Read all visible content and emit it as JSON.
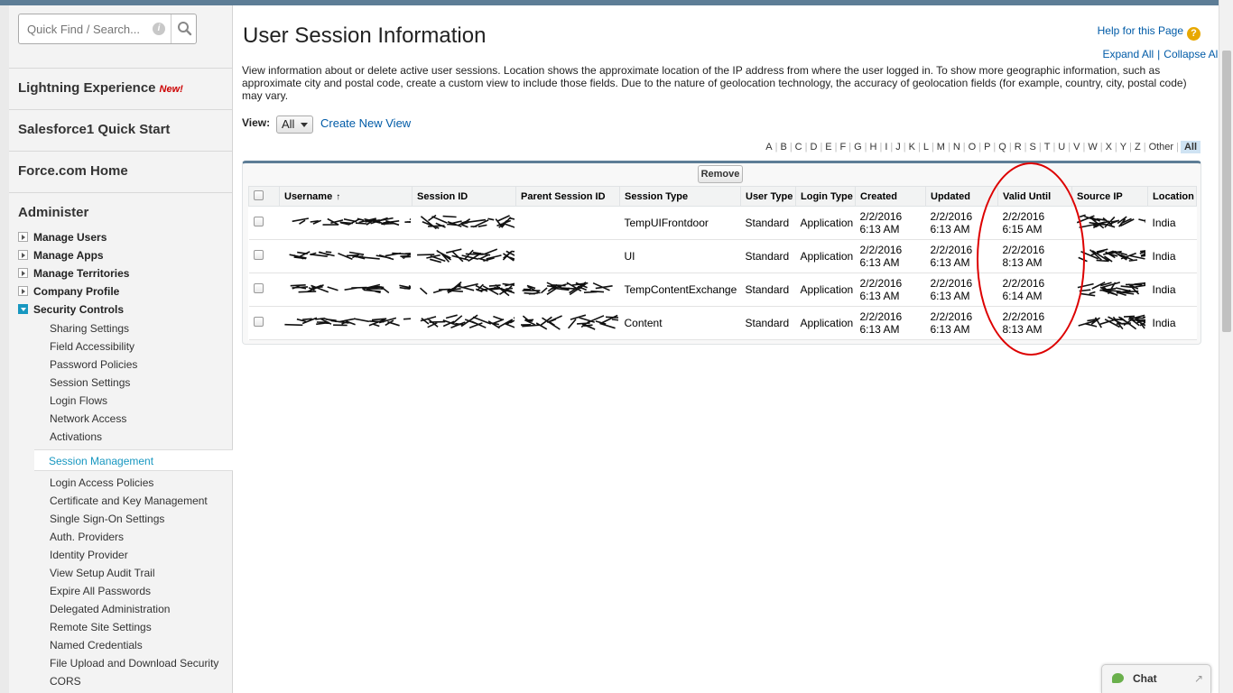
{
  "sidebar": {
    "search_placeholder": "Quick Find / Search...",
    "expand_all": "Expand All",
    "collapse_all": "Collapse All",
    "separator": "|",
    "sections": [
      "Lightning Experience",
      "Salesforce1 Quick Start",
      "Force.com Home",
      "Administer"
    ],
    "new_badge": "New!",
    "tree": [
      "Manage Users",
      "Manage Apps",
      "Manage Territories",
      "Company Profile",
      "Security Controls"
    ],
    "security_items": [
      "Sharing Settings",
      "Field Accessibility",
      "Password Policies",
      "Session Settings",
      "Login Flows",
      "Network Access",
      "Activations",
      "Session Management",
      "Login Access Policies",
      "Certificate and Key Management",
      "Single Sign-On Settings",
      "Auth. Providers",
      "Identity Provider",
      "View Setup Audit Trail",
      "Expire All Passwords",
      "Delegated Administration",
      "Remote Site Settings",
      "Named Credentials",
      "File Upload and Download Security",
      "CORS"
    ],
    "active_item": "Session Management"
  },
  "page": {
    "title": "User Session Information",
    "help_link": "Help for this Page",
    "description": "View information about or delete active user sessions. Location shows the approximate location of the IP address from where the user logged in. To show more geographic information, such as approximate city and postal code, create a custom view to include those fields. Due to the nature of geolocation technology, the accuracy of geolocation fields (for example, country, city, postal code) may vary.",
    "view_label": "View:",
    "view_selected": "All",
    "create_view": "Create New View",
    "alphabet": [
      "A",
      "B",
      "C",
      "D",
      "E",
      "F",
      "G",
      "H",
      "I",
      "J",
      "K",
      "L",
      "M",
      "N",
      "O",
      "P",
      "Q",
      "R",
      "S",
      "T",
      "U",
      "V",
      "W",
      "X",
      "Y",
      "Z",
      "Other",
      "All"
    ],
    "remove_button": "Remove"
  },
  "table": {
    "columns": [
      "Username",
      "Session ID",
      "Parent Session ID",
      "Session Type",
      "User Type",
      "Login Type",
      "Created",
      "Updated",
      "Valid Until",
      "Source IP",
      "Location"
    ],
    "sort_indicator": "↑",
    "rows": [
      {
        "session_type": "TempUIFrontdoor",
        "user_type": "Standard",
        "login_type": "Application",
        "created": "2/2/2016 6:13 AM",
        "updated": "2/2/2016 6:13 AM",
        "valid_until": "2/2/2016 6:15 AM",
        "location": "India"
      },
      {
        "session_type": "UI",
        "user_type": "Standard",
        "login_type": "Application",
        "created": "2/2/2016 6:13 AM",
        "updated": "2/2/2016 6:13 AM",
        "valid_until": "2/2/2016 8:13 AM",
        "location": "India"
      },
      {
        "session_type": "TempContentExchange",
        "user_type": "Standard",
        "login_type": "Application",
        "created": "2/2/2016 6:13 AM",
        "updated": "2/2/2016 6:13 AM",
        "valid_until": "2/2/2016 6:14 AM",
        "location": "India"
      },
      {
        "session_type": "Content",
        "user_type": "Standard",
        "login_type": "Application",
        "created": "2/2/2016 6:13 AM",
        "updated": "2/2/2016 6:13 AM",
        "valid_until": "2/2/2016 8:13 AM",
        "location": "India"
      }
    ]
  },
  "chat": {
    "label": "Chat"
  },
  "colors": {
    "link": "#015ba7",
    "accent": "#1797c0",
    "header_bar": "#5d7d96",
    "annotation": "#dd0000"
  }
}
